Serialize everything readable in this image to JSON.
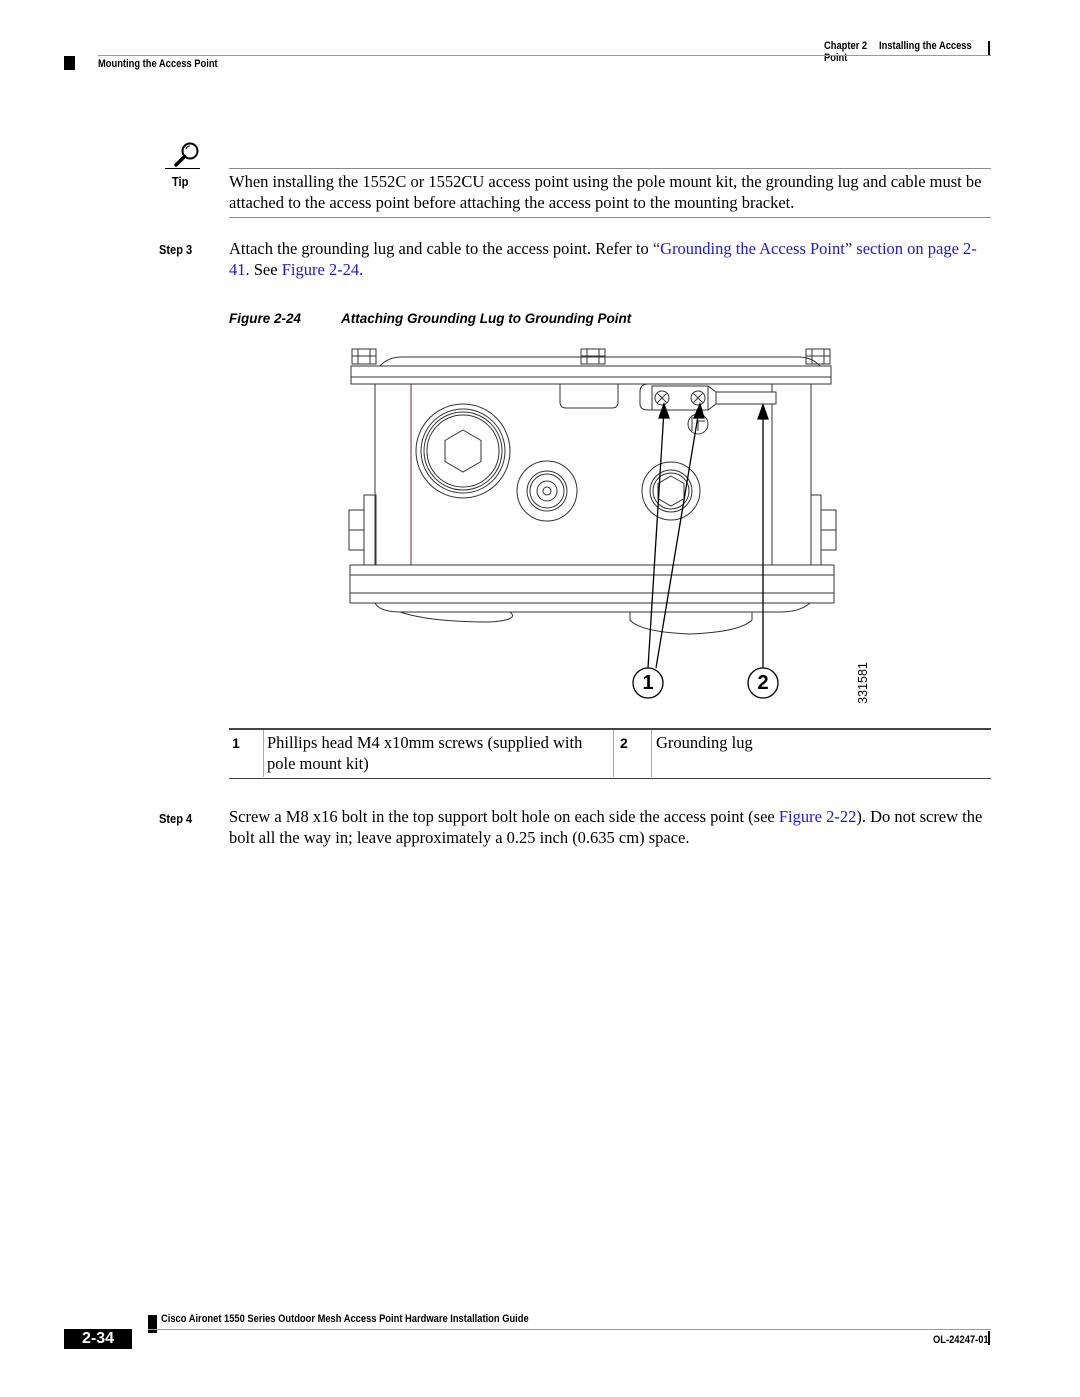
{
  "header": {
    "chapter": "Chapter 2",
    "chapter_title": "Installing the Access Point",
    "section": "Mounting the Access Point"
  },
  "tip": {
    "icon": "magnifier-icon",
    "label": "Tip",
    "text": "When installing the 1552C or 1552CU access point using the pole mount kit, the grounding lug and cable must be attached to the access point before attaching the access point to the mounting bracket."
  },
  "step3": {
    "label": "Step 3",
    "text_before": "Attach the grounding lug and cable to the access point. Refer to ",
    "link1": "“Grounding the Access Point” section on page 2-41",
    "text_mid": ". See ",
    "link2": "Figure 2-24",
    "text_after": "."
  },
  "figure": {
    "number": "Figure 2-24",
    "title": "Attaching Grounding Lug to Grounding Point",
    "art_id": "331581",
    "callout_1": "1",
    "callout_2": "2"
  },
  "callout_table": [
    {
      "num": "1",
      "text": "Phillips head M4 x10mm screws (supplied with pole mount kit)"
    },
    {
      "num": "2",
      "text": "Grounding lug"
    }
  ],
  "step4": {
    "label": "Step 4",
    "text_before": "Screw a M8 x16 bolt in the top support bolt hole on each side the access point (see ",
    "link": "Figure 2-22",
    "text_after": "). Do not screw the bolt all the way in; leave approximately a 0.25 inch (0.635 cm) space."
  },
  "footer": {
    "guide_title": "Cisco Aironet 1550 Series Outdoor Mesh Access Point Hardware Installation Guide",
    "page_number": "2-34",
    "doc_id": "OL-24247-01"
  }
}
